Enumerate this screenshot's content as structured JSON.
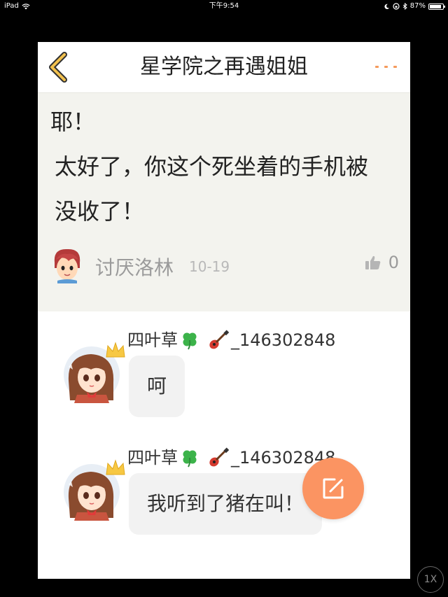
{
  "status_bar": {
    "device": "iPad",
    "time": "下午9:54",
    "battery": "87%"
  },
  "nav": {
    "title": "星学院之再遇姐姐"
  },
  "post": {
    "line1": "耶！",
    "line2": "太好了，你这个死坐着的手机被",
    "line3": "没收了！",
    "author": "讨厌洛林",
    "date": "10-19",
    "likes": "0"
  },
  "replies": [
    {
      "name_prefix": "四叶草",
      "name_suffix": "_146302848",
      "text": "呵"
    },
    {
      "name_prefix": "四叶草",
      "name_suffix": "_146302848",
      "text": "我听到了猪在叫！"
    }
  ],
  "zoom": {
    "label": "1X"
  },
  "colors": {
    "accent": "#fb9462",
    "back_arrow": "#f2c14e",
    "post_bg": "#f3f3ee",
    "bubble_bg": "#f2f2f2"
  },
  "icons": {
    "back": "chevron-left-icon",
    "more": "more-dots-icon",
    "like": "thumbs-up-icon",
    "fab": "edit-icon",
    "clover": "clover-emoji-icon",
    "guitar": "guitar-emoji-icon",
    "crown": "crown-icon"
  }
}
